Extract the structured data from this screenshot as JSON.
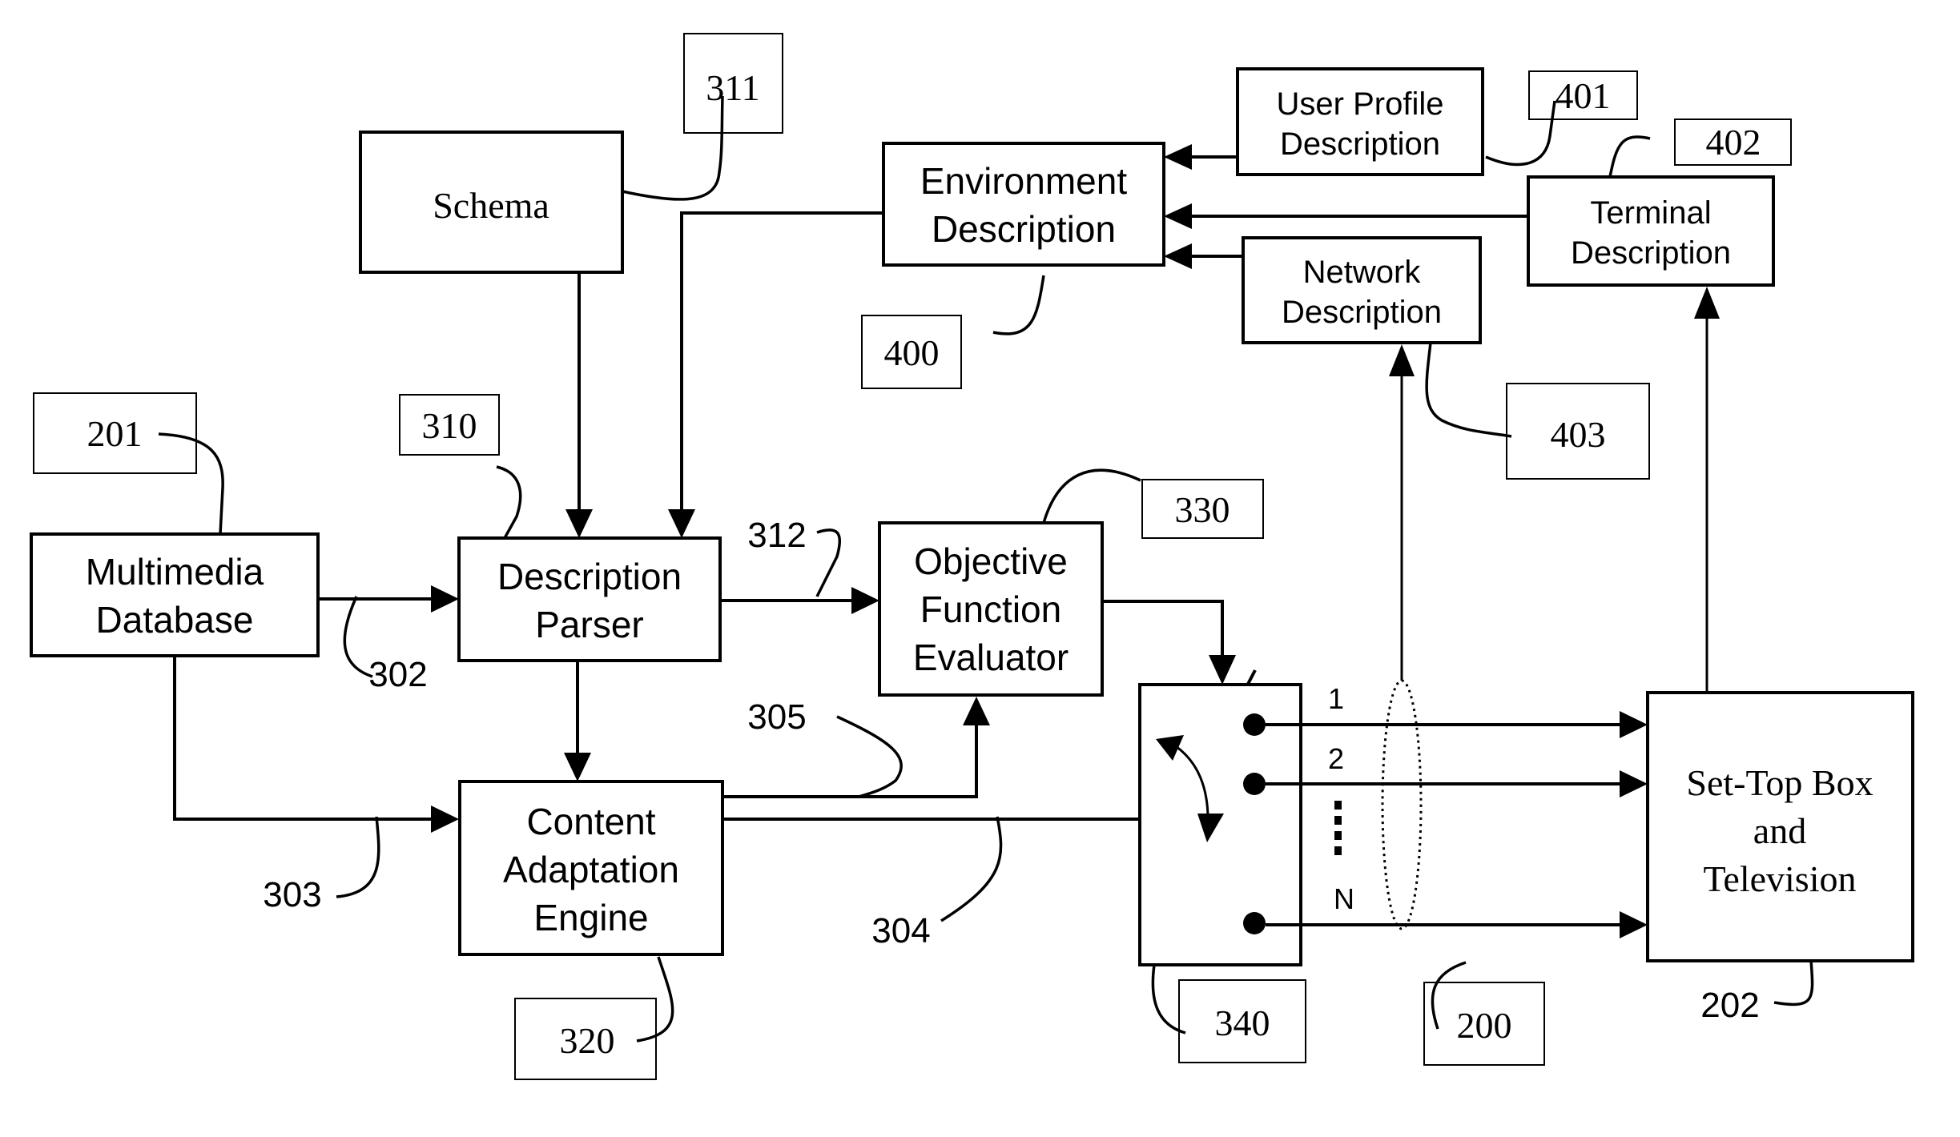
{
  "blocks": {
    "schema": {
      "lines": [
        "Schema"
      ],
      "ref": "311"
    },
    "environment": {
      "lines": [
        "Environment",
        "Description"
      ],
      "ref": "400"
    },
    "user_profile": {
      "lines": [
        "User Profile",
        "Description"
      ],
      "ref": "401"
    },
    "terminal": {
      "lines": [
        "Terminal",
        "Description"
      ],
      "ref": "402"
    },
    "network": {
      "lines": [
        "Network",
        "Description"
      ],
      "ref": "403"
    },
    "multimedia_db": {
      "lines": [
        "Multimedia",
        "Database"
      ],
      "ref": "201"
    },
    "description_parser": {
      "lines": [
        "Description",
        "Parser"
      ],
      "ref": "310"
    },
    "objective_evaluator": {
      "lines": [
        "Objective",
        "Function",
        "Evaluator"
      ],
      "ref": "330"
    },
    "content_adaptation": {
      "lines": [
        "Content",
        "Adaptation",
        "Engine"
      ],
      "ref": "320"
    },
    "switch": {
      "ref": "340"
    },
    "set_top_box": {
      "lines": [
        "Set-Top Box",
        "and",
        "Television"
      ],
      "ref": "202"
    }
  },
  "connections": {
    "db_to_parser": "302",
    "db_to_engine": "303",
    "engine_to_switch": "304",
    "engine_to_evaluator": "305",
    "parser_to_evaluator": "312",
    "channels_group": "200"
  },
  "ports": [
    "1",
    "2",
    "N"
  ],
  "ellipsis": "⋮"
}
